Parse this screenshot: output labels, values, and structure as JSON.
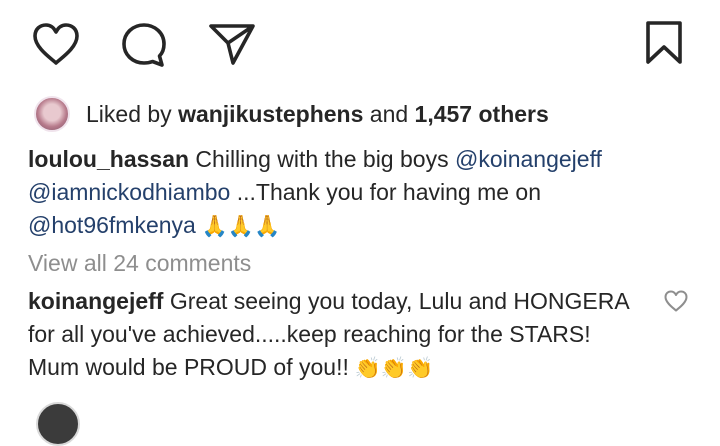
{
  "likes": {
    "prefix": "Liked by ",
    "user": "wanjikustephens",
    "conjunction": " and ",
    "count": "1,457 others"
  },
  "caption": {
    "username": "loulou_hassan",
    "text1": " Chilling with the big boys ",
    "mention1": "@koinangejeff",
    "mention2": "@iamnickodhiambo",
    "text2": " ...Thank you for having me on",
    "mention3": "@hot96fmkenya",
    "emoji": " 🙏🙏🙏"
  },
  "view_all_comments": "View all 24 comments",
  "comment": {
    "username": "koinangejeff",
    "text": " Great seeing you today, Lulu and HONGERA for all you've achieved.....keep reaching for the STARS! Mum would be PROUD of you!!",
    "emoji": " 👏👏👏"
  },
  "icons": {
    "like": "heart-icon",
    "comment": "comment-icon",
    "share": "send-icon",
    "save": "bookmark-icon",
    "comment_like": "heart-icon"
  },
  "colors": {
    "text": "#262626",
    "mention": "#24406b",
    "muted": "#8e8e8e"
  }
}
